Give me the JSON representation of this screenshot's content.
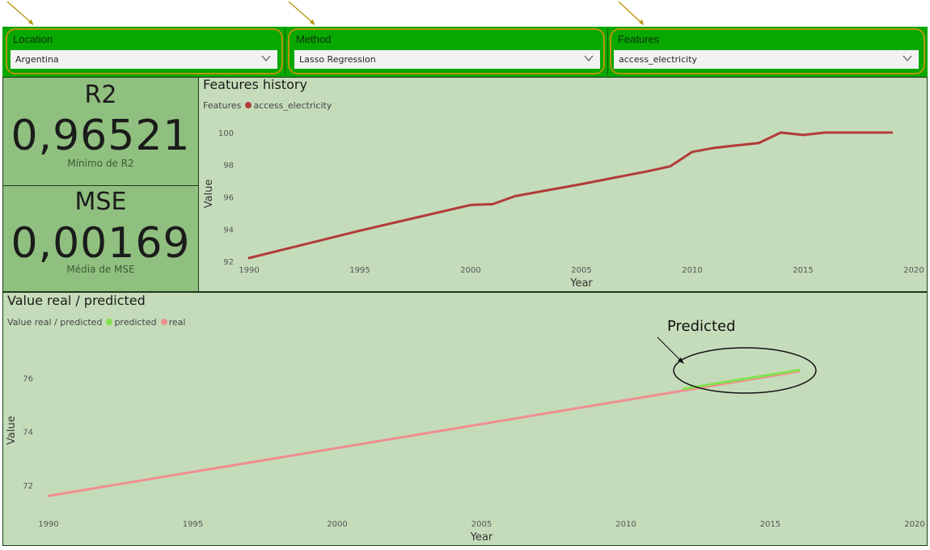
{
  "slicers": [
    {
      "title": "Location",
      "value": "Argentina"
    },
    {
      "title": "Method",
      "value": "Lasso Regression"
    },
    {
      "title": "Features",
      "value": "access_electricity"
    }
  ],
  "cards": {
    "r2": {
      "title": "R2",
      "value": "0,96521",
      "subtitle": "Mínimo de R2"
    },
    "mse": {
      "title": "MSE",
      "value": "0,00169",
      "subtitle": "Média de MSE"
    }
  },
  "features_history": {
    "title": "Features history",
    "legend_label": "Features",
    "chart_data": {
      "type": "line",
      "title": "Features history",
      "xlabel": "Year",
      "ylabel": "Value",
      "xlim": [
        1990,
        2020
      ],
      "ylim": [
        91.8,
        100.6
      ],
      "x_ticks": [
        1990,
        1995,
        2000,
        2005,
        2010,
        2015,
        2020
      ],
      "y_ticks": [
        92,
        94,
        96,
        98,
        100
      ],
      "legend_placement": "top-left",
      "series": [
        {
          "name": "access_electricity",
          "color": "#b23b37",
          "x": [
            1990,
            1995,
            2000,
            2001,
            2002,
            2005,
            2008,
            2009,
            2010,
            2011,
            2012,
            2013,
            2014,
            2015,
            2016,
            2017,
            2018,
            2019
          ],
          "y": [
            92.2,
            93.9,
            95.5,
            95.55,
            96.05,
            96.8,
            97.6,
            97.9,
            98.8,
            99.05,
            99.2,
            99.35,
            100.0,
            99.85,
            100.0,
            100.0,
            100.0,
            100.0
          ]
        }
      ]
    }
  },
  "value_real_predicted": {
    "title": "Value real / predicted",
    "legend_label": "Value real / predicted",
    "chart_data": {
      "type": "line",
      "title": "Value real / predicted",
      "xlabel": "Year",
      "ylabel": "Value",
      "xlim": [
        1990,
        2020
      ],
      "ylim": [
        71.3,
        76.8
      ],
      "x_ticks": [
        1990,
        1995,
        2000,
        2005,
        2010,
        2015,
        2020
      ],
      "y_ticks": [
        72,
        74,
        76
      ],
      "legend_placement": "top-left",
      "series": [
        {
          "name": "predicted",
          "color": "#7fe34f",
          "x": [
            2012,
            2016
          ],
          "y": [
            75.6,
            76.3
          ]
        },
        {
          "name": "real",
          "color": "#f08f8f",
          "x": [
            1990,
            2016
          ],
          "y": [
            71.6,
            76.25
          ]
        }
      ]
    }
  },
  "annotation": {
    "text": "Predicted"
  },
  "colors": {
    "slicer_band": "#07a800",
    "card_bg": "#90c07f",
    "panel_bg": "#c5dcba",
    "highlight_ring": "#b7950b"
  }
}
